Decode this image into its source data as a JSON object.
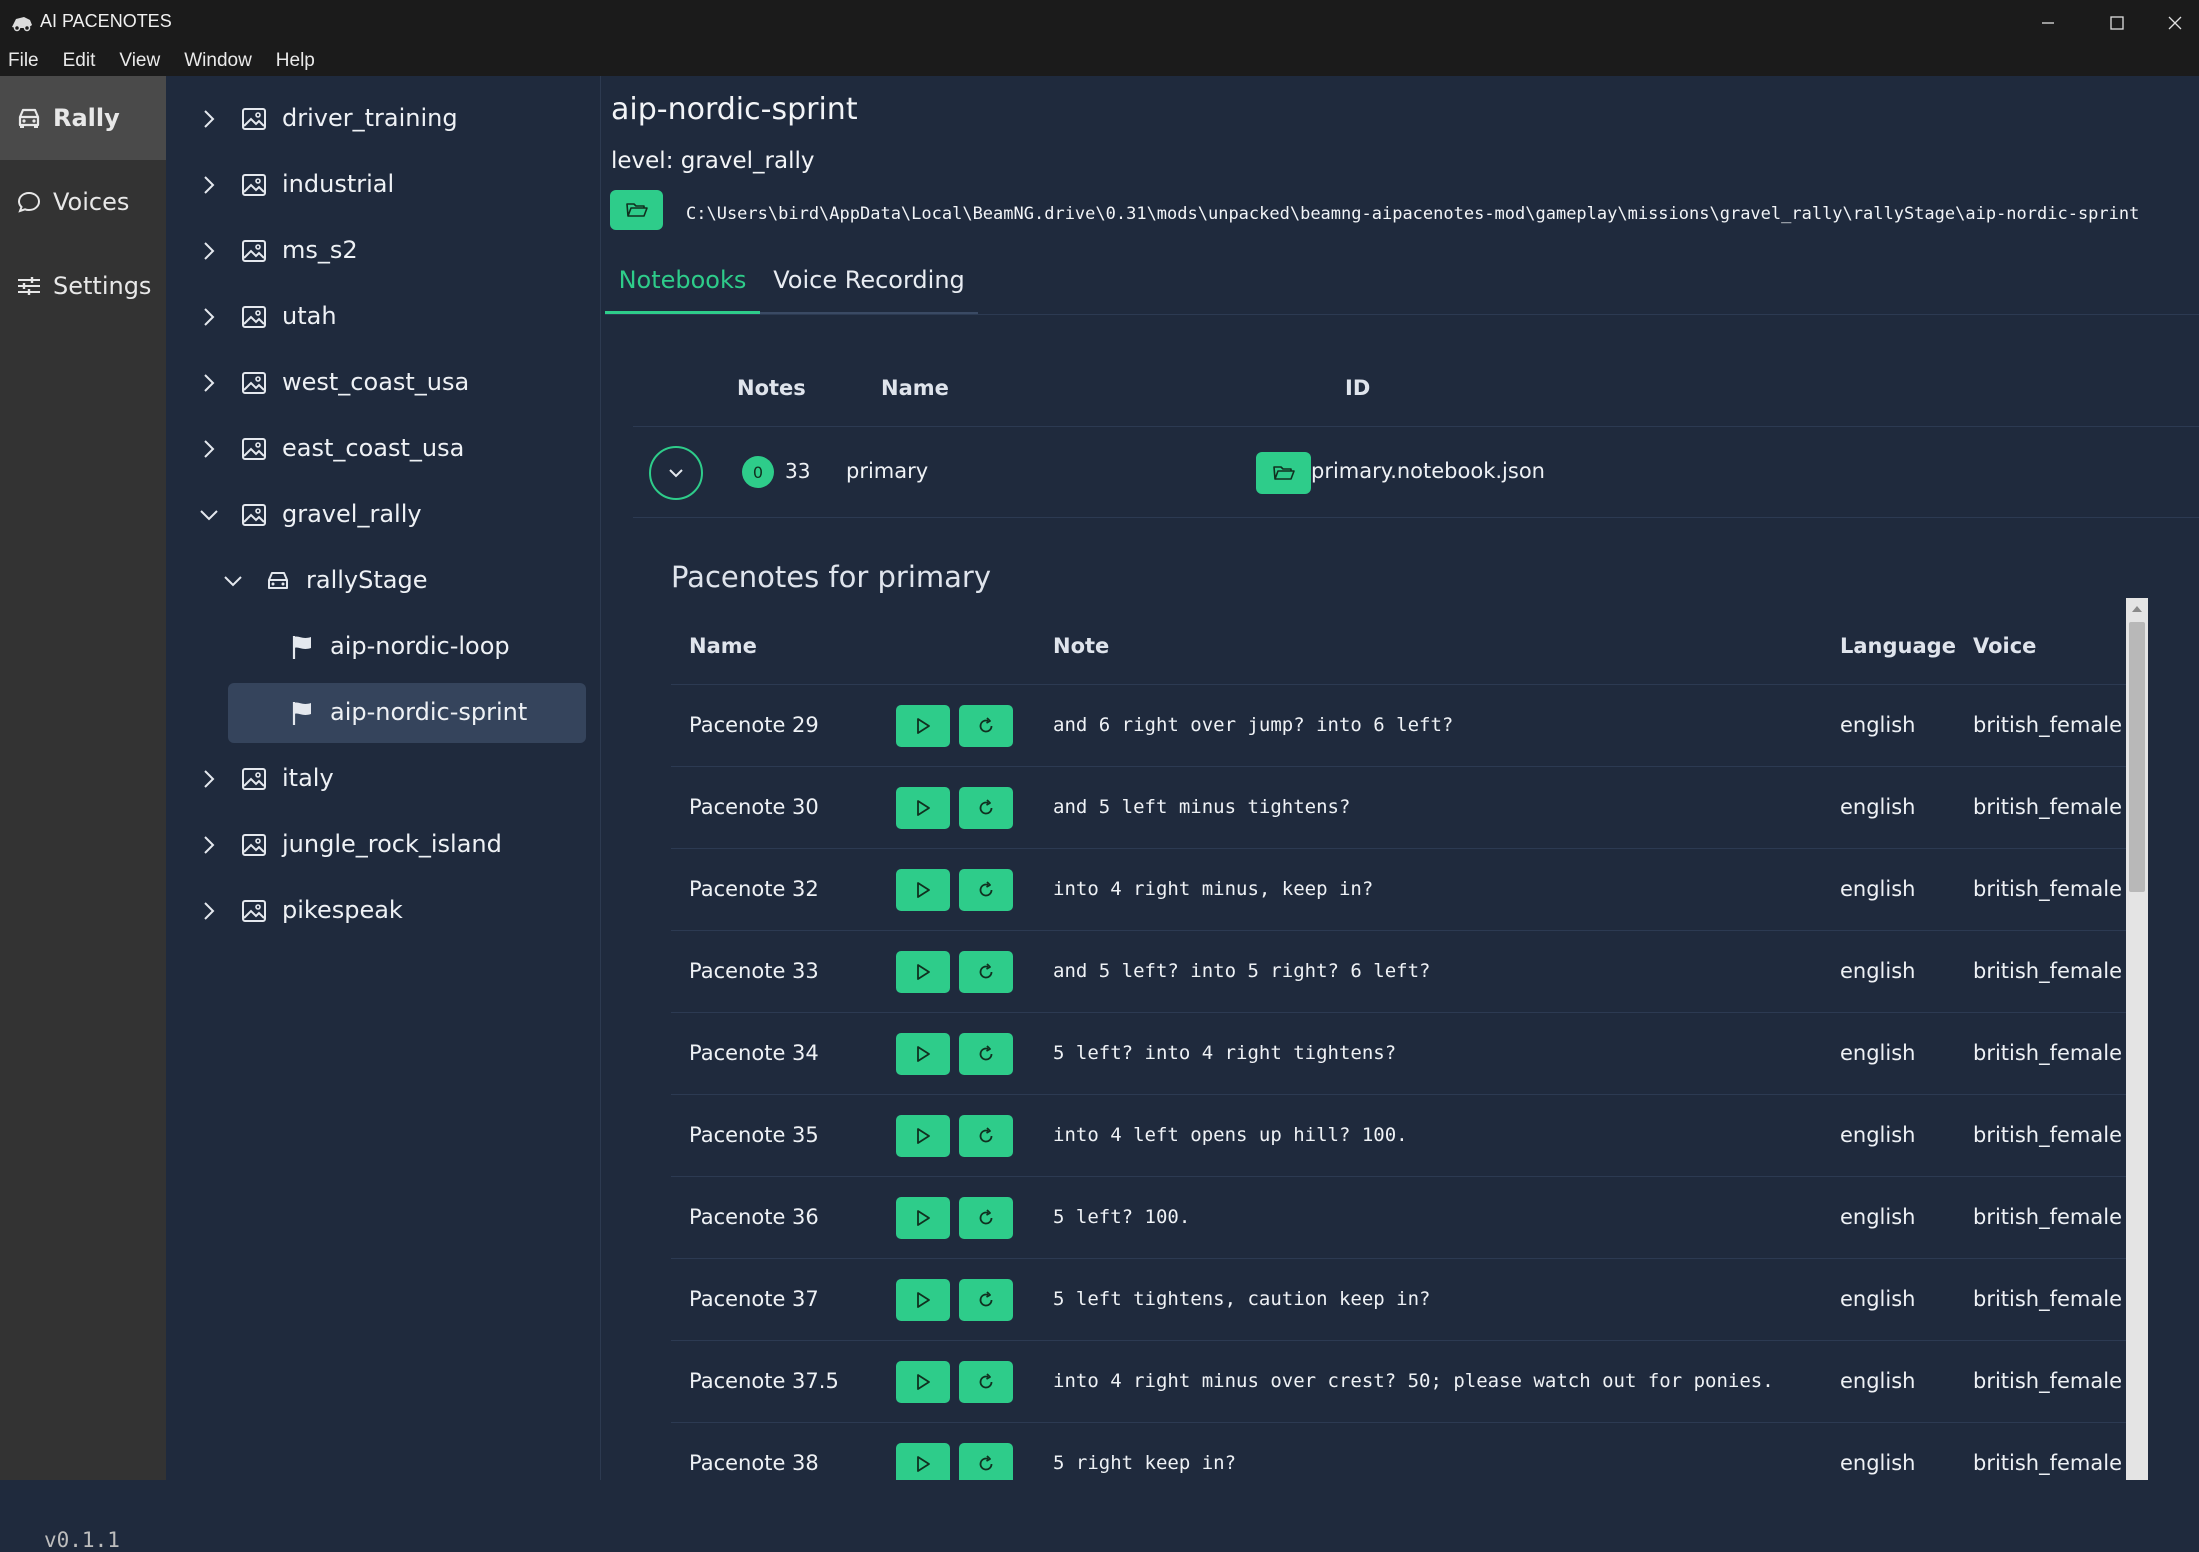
{
  "window": {
    "title": "AI PACENOTES"
  },
  "menu": [
    "File",
    "Edit",
    "View",
    "Window",
    "Help"
  ],
  "nav": {
    "items": [
      {
        "label": "Rally",
        "icon": "car-icon"
      },
      {
        "label": "Voices",
        "icon": "chat-bubble-icon"
      },
      {
        "label": "Settings",
        "icon": "sliders-icon"
      }
    ],
    "version": "v0.1.1"
  },
  "tree": [
    {
      "label": "driver_training"
    },
    {
      "label": "industrial"
    },
    {
      "label": "ms_s2"
    },
    {
      "label": "utah"
    },
    {
      "label": "west_coast_usa"
    },
    {
      "label": "east_coast_usa"
    },
    {
      "label": "gravel_rally"
    },
    {
      "label": "rallyStage"
    },
    {
      "label": "aip-nordic-loop"
    },
    {
      "label": "aip-nordic-sprint"
    },
    {
      "label": "italy"
    },
    {
      "label": "jungle_rock_island"
    },
    {
      "label": "pikespeak"
    }
  ],
  "stage": {
    "title": "aip-nordic-sprint",
    "level": "level: gravel_rally",
    "path": "C:\\Users\\bird\\AppData\\Local\\BeamNG.drive\\0.31\\mods\\unpacked\\beamng-aipacenotes-mod\\gameplay\\missions\\gravel_rally\\rallyStage\\aip-nordic-sprint"
  },
  "tabs": [
    "Notebooks",
    "Voice Recording"
  ],
  "notebooks": {
    "headers": {
      "notes": "Notes",
      "name": "Name",
      "id": "ID"
    },
    "rows": [
      {
        "badge": "0",
        "count": "33",
        "name": "primary",
        "id": "primary.notebook.json"
      }
    ]
  },
  "pacenotes": {
    "title": "Pacenotes for primary",
    "headers": {
      "name": "Name",
      "note": "Note",
      "language": "Language",
      "voice": "Voice"
    },
    "rows": [
      {
        "name": "Pacenote 29",
        "note": "and 6 right over jump? into 6 left?",
        "language": "english",
        "voice": "british_female"
      },
      {
        "name": "Pacenote 30",
        "note": "and 5 left minus tightens?",
        "language": "english",
        "voice": "british_female"
      },
      {
        "name": "Pacenote 32",
        "note": "into 4 right minus, keep in?",
        "language": "english",
        "voice": "british_female"
      },
      {
        "name": "Pacenote 33",
        "note": "and 5 left? into 5 right? 6 left?",
        "language": "english",
        "voice": "british_female"
      },
      {
        "name": "Pacenote 34",
        "note": "5 left? into 4 right tightens?",
        "language": "english",
        "voice": "british_female"
      },
      {
        "name": "Pacenote 35",
        "note": "into 4 left opens up hill? 100.",
        "language": "english",
        "voice": "british_female"
      },
      {
        "name": "Pacenote 36",
        "note": "5 left? 100.",
        "language": "english",
        "voice": "british_female"
      },
      {
        "name": "Pacenote 37",
        "note": "5 left tightens, caution keep in?",
        "language": "english",
        "voice": "british_female"
      },
      {
        "name": "Pacenote 37.5",
        "note": "into 4 right minus over crest? 50; please watch out for ponies.",
        "language": "english",
        "voice": "british_female"
      },
      {
        "name": "Pacenote 38",
        "note": "5 right keep in?",
        "language": "english",
        "voice": "british_female"
      }
    ]
  },
  "colors": {
    "accent": "#2ecc8a",
    "background": "#1f2a3d",
    "sidebar": "#333333",
    "titlebar": "#1b1b1b"
  }
}
